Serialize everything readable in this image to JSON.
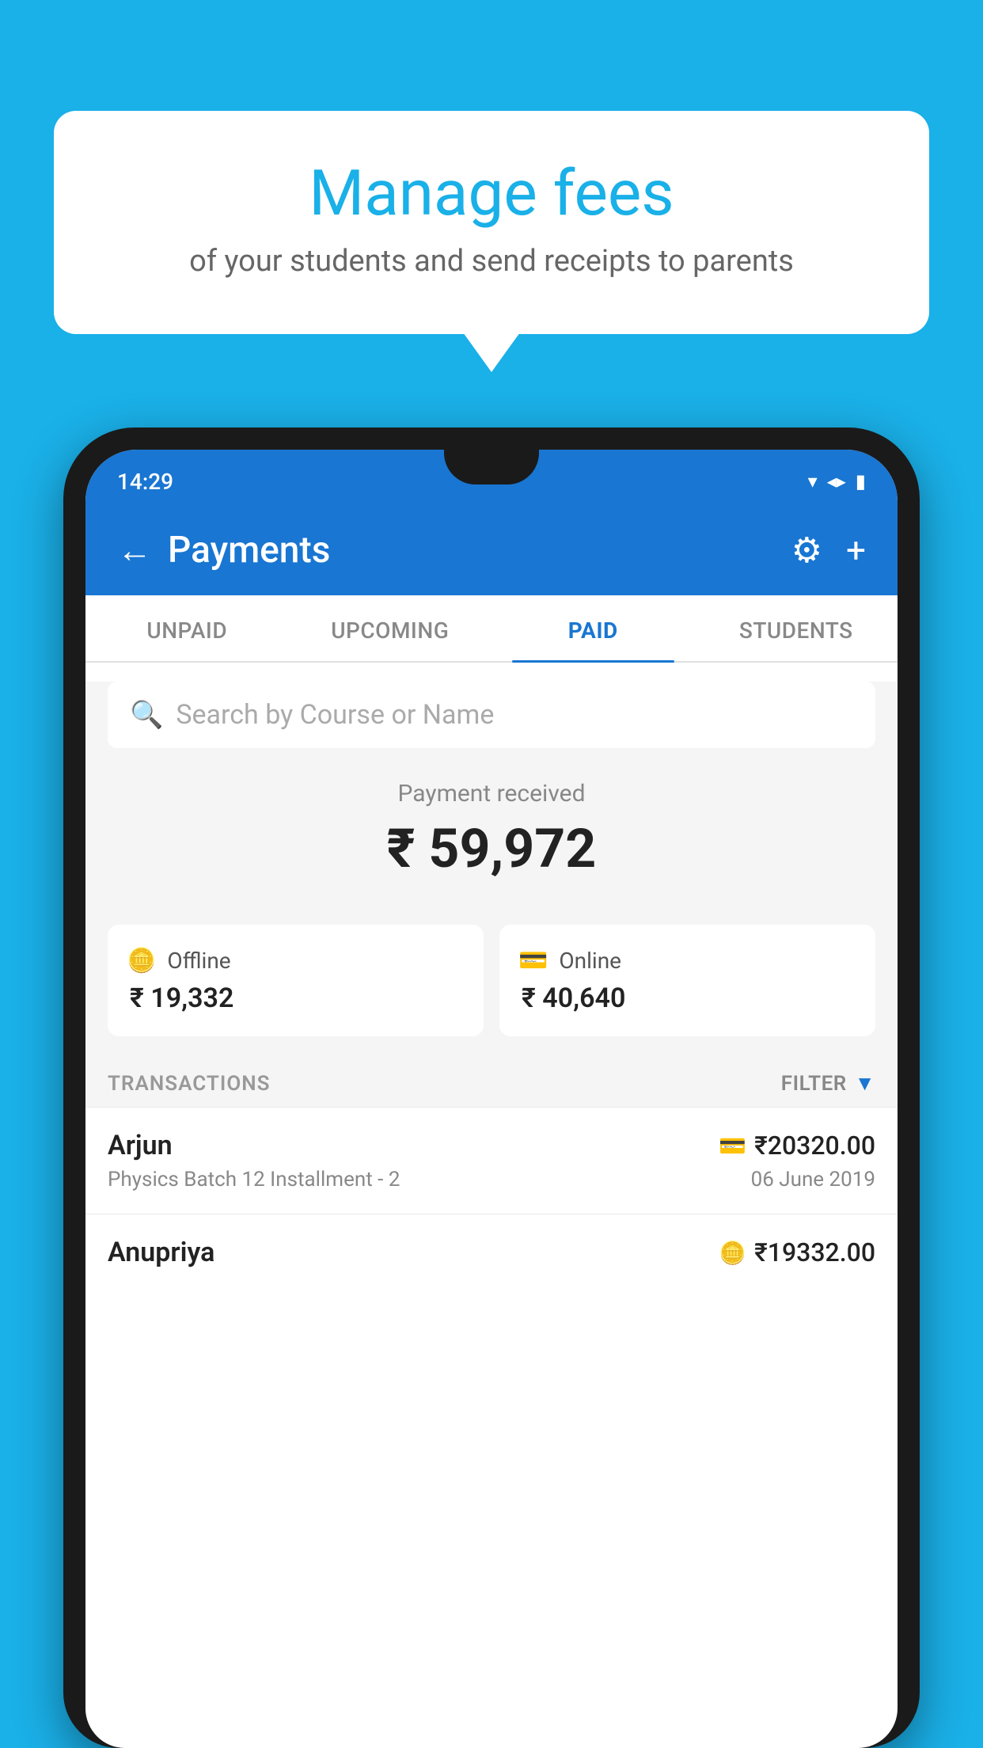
{
  "page": {
    "background_color": "#1ab0e8"
  },
  "bubble": {
    "title": "Manage fees",
    "subtitle": "of your students and send receipts to parents"
  },
  "status_bar": {
    "time": "14:29",
    "wifi_icon": "▼",
    "signal_icon": "▲",
    "battery_icon": "▮"
  },
  "header": {
    "title": "Payments",
    "back_label": "←",
    "settings_icon": "⚙",
    "add_icon": "+"
  },
  "tabs": [
    {
      "label": "UNPAID",
      "active": false
    },
    {
      "label": "UPCOMING",
      "active": false
    },
    {
      "label": "PAID",
      "active": true
    },
    {
      "label": "STUDENTS",
      "active": false
    }
  ],
  "search": {
    "placeholder": "Search by Course or Name"
  },
  "payment_summary": {
    "label": "Payment received",
    "amount": "₹ 59,972",
    "offline_label": "Offline",
    "offline_amount": "₹ 19,332",
    "online_label": "Online",
    "online_amount": "₹ 40,640"
  },
  "transactions": {
    "section_label": "TRANSACTIONS",
    "filter_label": "FILTER",
    "items": [
      {
        "name": "Arjun",
        "course": "Physics Batch 12 Installment - 2",
        "amount": "₹20320.00",
        "date": "06 June 2019",
        "payment_type": "online"
      },
      {
        "name": "Anupriya",
        "course": "",
        "amount": "₹19332.00",
        "date": "",
        "payment_type": "offline"
      }
    ]
  }
}
